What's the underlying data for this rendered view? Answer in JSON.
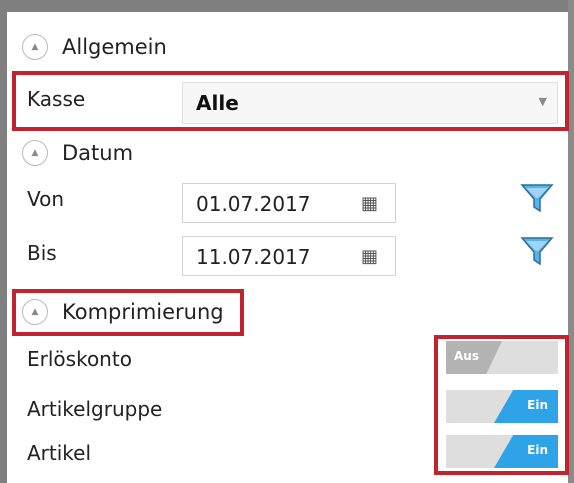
{
  "sections": {
    "allgemein": "Allgemein",
    "datum": "Datum",
    "komprimierung": "Komprimierung"
  },
  "kasse": {
    "label": "Kasse",
    "value": "Alle"
  },
  "datum": {
    "von": {
      "label": "Von",
      "value": "01.07.2017"
    },
    "bis": {
      "label": "Bis",
      "value": "11.07.2017"
    }
  },
  "komprimierung": {
    "items": [
      {
        "label": "Erlöskonto",
        "state": "Aus"
      },
      {
        "label": "Artikelgruppe",
        "state": "Ein"
      },
      {
        "label": "Artikel",
        "state": "Ein"
      }
    ]
  },
  "colors": {
    "accent": "#2ea3e8",
    "highlight": "#c0252f"
  },
  "icons": {
    "collapse": "triangle-up-icon",
    "calendar": "calendar-icon",
    "filter": "funnel-icon",
    "dropdown": "chevron-down-icon"
  }
}
